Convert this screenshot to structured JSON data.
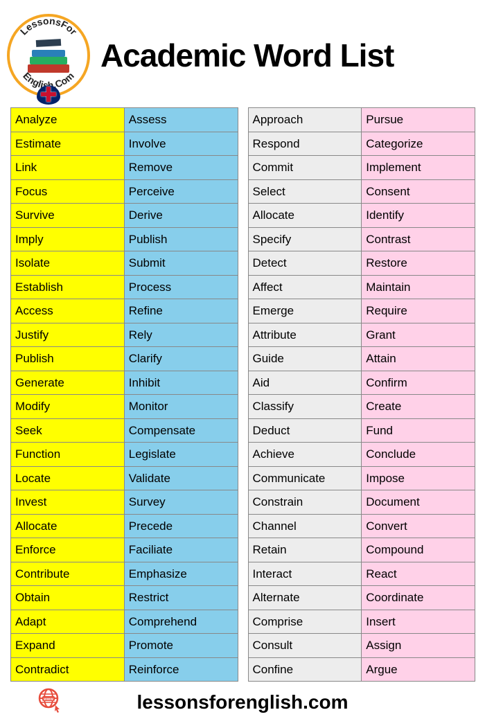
{
  "title": "Academic Word List",
  "footer": "lessonsforenglish.com",
  "columns": {
    "yellow": [
      "Analyze",
      "Estimate",
      "Link",
      "Focus",
      "Survive",
      "Imply",
      "Isolate",
      "Establish",
      "Access",
      "Justify",
      "Publish",
      "Generate",
      "Modify",
      "Seek",
      "Function",
      "Locate",
      "Invest",
      "Allocate",
      "Enforce",
      "Contribute",
      "Obtain",
      "Adapt",
      "Expand",
      "Contradict"
    ],
    "blue": [
      "Assess",
      "Involve",
      "Remove",
      "Perceive",
      "Derive",
      "Publish",
      "Submit",
      "Process",
      "Refine",
      "Rely",
      "Clarify",
      "Inhibit",
      "Monitor",
      "Compensate",
      "Legislate",
      "Validate",
      "Survey",
      "Precede",
      "Faciliate",
      "Emphasize",
      "Restrict",
      "Comprehend",
      "Promote",
      "Reinforce"
    ],
    "grey": [
      "Approach",
      "Respond",
      "Commit",
      "Select",
      "Allocate",
      "Specify",
      "Detect",
      "Affect",
      "Emerge",
      "Attribute",
      "Guide",
      "Aid",
      "Classify",
      "Deduct",
      "Achieve",
      "Communicate",
      "Constrain",
      "Channel",
      "Retain",
      "Interact",
      "Alternate",
      "Comprise",
      "Consult",
      "Confine"
    ],
    "pink": [
      "Pursue",
      "Categorize",
      "Implement",
      "Consent",
      "Identify",
      "Contrast",
      "Restore",
      "Maintain",
      "Require",
      "Grant",
      "Attain",
      "Confirm",
      "Create",
      "Fund",
      "Conclude",
      "Impose",
      "Document",
      "Convert",
      "Compound",
      "React",
      "Coordinate",
      "Insert",
      "Assign",
      "Argue"
    ]
  }
}
